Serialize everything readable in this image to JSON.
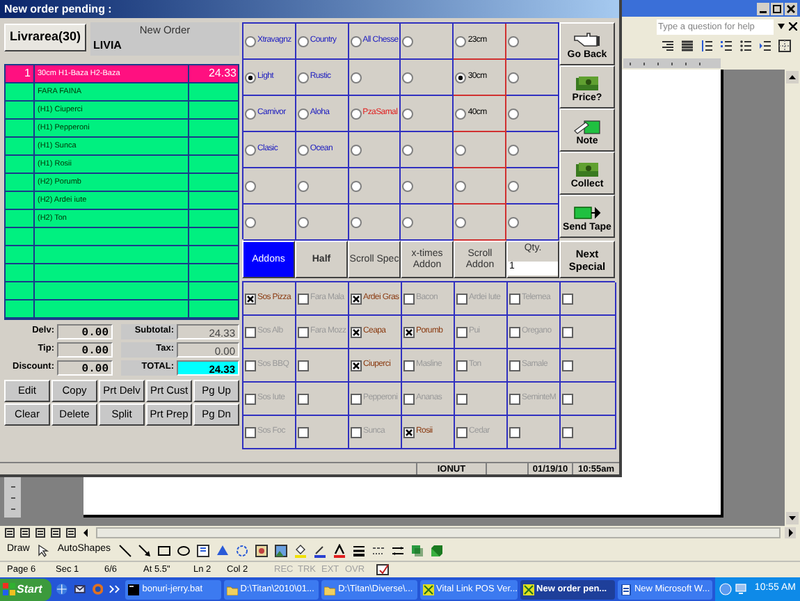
{
  "window": {
    "title": "New order pending :"
  },
  "order_type_button": "Livrarea(30)",
  "order_header": {
    "label": "New Order",
    "customer": "LIVIA"
  },
  "order_lines": [
    {
      "qty": "1",
      "text": "30cm  H1-Baza H2-Baza",
      "price": "24.33",
      "selected": true
    },
    {
      "text": "FARA FAINA",
      "selected": false
    },
    {
      "text": "(H1) Ciuperci",
      "selected": false
    },
    {
      "text": "(H1) Pepperoni",
      "selected": false
    },
    {
      "text": "(H1) Sunca",
      "selected": false
    },
    {
      "text": "(H1) Rosii",
      "selected": false
    },
    {
      "text": "(H2) Porumb",
      "selected": false
    },
    {
      "text": "(H2) Ardei iute",
      "selected": false
    },
    {
      "text": "(H2) Ton",
      "selected": false
    }
  ],
  "charges": [
    {
      "label": "Delv:",
      "value": "0.00"
    },
    {
      "label": "Tip:",
      "value": "0.00"
    },
    {
      "label": "Discount:",
      "value": "0.00"
    }
  ],
  "summary": [
    {
      "label": "Subtotal:",
      "value": "24.33",
      "highlight": false
    },
    {
      "label": "Tax:",
      "value": "0.00",
      "highlight": false
    },
    {
      "label": "TOTAL:",
      "value": "24.33",
      "highlight": true
    }
  ],
  "actions": [
    [
      "Edit",
      "Copy",
      "Prt Delv",
      "Prt Cust",
      "Pg Up"
    ],
    [
      "Clear",
      "Delete",
      "Split",
      "Prt Prep",
      "Pg Dn"
    ]
  ],
  "options": [
    [
      {
        "label": "Xtravagnz",
        "selected": false,
        "color": "#2020c0"
      },
      {
        "label": "Country",
        "selected": false,
        "color": "#2020c0"
      },
      {
        "label": "All Chesse",
        "selected": false,
        "color": "#2020c0"
      },
      {
        "selected": false
      },
      {
        "label": "23cm",
        "selected": false
      },
      {
        "selected": false
      }
    ],
    [
      {
        "label": "Light",
        "selected": true,
        "color": "#2020c0"
      },
      {
        "label": "Rustic",
        "selected": false,
        "color": "#2020c0"
      },
      {
        "selected": false
      },
      {
        "selected": false
      },
      {
        "label": "30cm",
        "selected": true
      },
      {
        "selected": false
      }
    ],
    [
      {
        "label": "Carnivor",
        "selected": false,
        "color": "#2020c0"
      },
      {
        "label": "Aloha",
        "selected": false,
        "color": "#2020c0"
      },
      {
        "label": "PzaSamal",
        "selected": false,
        "color": "#e02020"
      },
      {
        "selected": false
      },
      {
        "label": "40cm",
        "selected": false
      },
      {
        "selected": false
      }
    ],
    [
      {
        "label": "Clasic",
        "selected": false,
        "color": "#2020c0"
      },
      {
        "label": "Ocean",
        "selected": false,
        "color": "#2020c0"
      },
      {
        "selected": false
      },
      {
        "selected": false
      },
      {
        "selected": false
      },
      {
        "selected": false
      }
    ],
    [
      {
        "selected": false
      },
      {
        "selected": false
      },
      {
        "selected": false
      },
      {
        "selected": false
      },
      {
        "selected": false
      },
      {
        "selected": false
      }
    ],
    [
      {
        "selected": false
      },
      {
        "selected": false
      },
      {
        "selected": false
      },
      {
        "selected": false
      },
      {
        "selected": false
      },
      {
        "selected": false
      }
    ]
  ],
  "side_buttons": [
    {
      "label": "Go Back",
      "kind": "hand"
    },
    {
      "label": "Price?",
      "kind": "money"
    },
    {
      "label": "Note",
      "kind": "note"
    },
    {
      "label": "Collect",
      "kind": "money"
    },
    {
      "label": "Send Tape",
      "kind": "send"
    }
  ],
  "mode_buttons": [
    {
      "label": "Addons",
      "selected": true
    },
    {
      "label": "Half",
      "selected": false,
      "bold": true
    },
    {
      "label": "Scroll Spec",
      "selected": false
    },
    {
      "label": "x-times Addon",
      "selected": false
    },
    {
      "label": "Scroll Addon",
      "selected": false
    }
  ],
  "qty": {
    "label": "Qty.",
    "value": "1"
  },
  "next_button": "Next Special",
  "addons": [
    [
      {
        "label": "Sos Pizza",
        "checked": true
      },
      {
        "label": "Fara Mala",
        "checked": false
      },
      {
        "label": "Ardei Gras",
        "checked": true
      },
      {
        "label": "Bacon",
        "checked": false
      },
      {
        "label": "Ardei Iute",
        "checked": false
      },
      {
        "label": "Telemea",
        "checked": false
      },
      {
        "checked": false
      }
    ],
    [
      {
        "label": "Sos Alb",
        "checked": false
      },
      {
        "label": "Fara Mozz",
        "checked": false
      },
      {
        "label": "Ceapa",
        "checked": true
      },
      {
        "label": "Porumb",
        "checked": true
      },
      {
        "label": "Pui",
        "checked": false
      },
      {
        "label": "Oregano",
        "checked": false
      },
      {
        "checked": false
      }
    ],
    [
      {
        "label": "Sos BBQ",
        "checked": false
      },
      {
        "checked": false
      },
      {
        "label": "Ciuperci",
        "checked": true
      },
      {
        "label": "Masline",
        "checked": false
      },
      {
        "label": "Ton",
        "checked": false
      },
      {
        "label": "Samale",
        "checked": false
      },
      {
        "checked": false
      }
    ],
    [
      {
        "label": "Sos Iute",
        "checked": false
      },
      {
        "checked": false
      },
      {
        "label": "Pepperoni",
        "checked": false
      },
      {
        "label": "Ananas",
        "checked": false
      },
      {
        "checked": false
      },
      {
        "label": "SeminteM",
        "checked": false
      },
      {
        "checked": false
      }
    ],
    [
      {
        "label": "Sos Foc",
        "checked": false
      },
      {
        "checked": false
      },
      {
        "label": "Sunca",
        "checked": false
      },
      {
        "label": "Rosii",
        "checked": true
      },
      {
        "label": "Cedar",
        "checked": false
      },
      {
        "checked": false
      },
      {
        "checked": false
      }
    ]
  ],
  "status_strip": [
    "IONUT",
    "01/19/10",
    "10:55am"
  ],
  "word": {
    "help_placeholder": "Type a question for help",
    "draw_toolbar": [
      "Draw",
      "AutoShapes"
    ],
    "status_bar": [
      {
        "text": "Page 6",
        "disabled": false
      },
      {
        "text": "Sec 1",
        "disabled": false
      },
      {
        "text": "6/6",
        "disabled": false
      },
      {
        "text": "At 5.5\"",
        "disabled": false
      },
      {
        "text": "Ln 2",
        "disabled": false
      },
      {
        "text": "Col 2",
        "disabled": false
      },
      {
        "text": "REC",
        "disabled": true
      },
      {
        "text": "TRK",
        "disabled": true
      },
      {
        "text": "EXT",
        "disabled": true
      },
      {
        "text": "OVR",
        "disabled": true
      }
    ]
  },
  "taskbar": {
    "start": "Start",
    "items": [
      {
        "label": "bonuri-jerry.bat",
        "kind": "console",
        "selected": false
      },
      {
        "label": "D:\\Titan\\2010\\01...",
        "kind": "folder",
        "selected": false
      },
      {
        "label": "D:\\Titan\\Diverse\\...",
        "kind": "folder",
        "selected": false
      },
      {
        "label": "Vital Link POS Ver...",
        "kind": "app",
        "selected": false
      },
      {
        "label": "New order pen...",
        "kind": "app",
        "selected": true
      },
      {
        "label": "New Microsoft W...",
        "kind": "document",
        "selected": false
      }
    ],
    "clock": "10:55 AM"
  }
}
